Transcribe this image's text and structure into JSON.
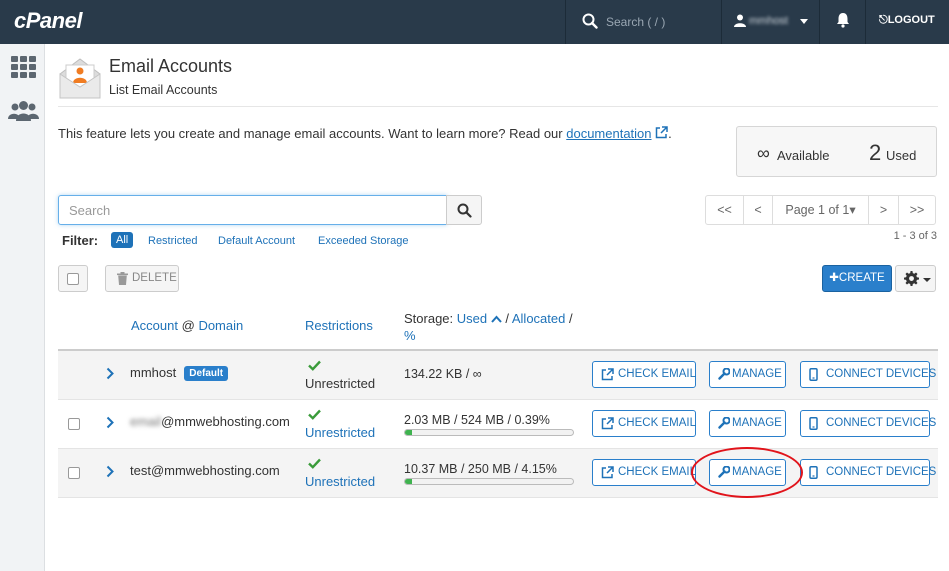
{
  "topbar": {
    "logo": "cPanel",
    "search_placeholder": "Search ( / )",
    "username": "mmhost",
    "logout_label": "LOGOUT"
  },
  "page": {
    "title": "Email Accounts",
    "subtitle": "List Email Accounts",
    "intro_text": "This feature lets you create and manage email accounts. Want to learn more? Read our ",
    "intro_link": "documentation",
    "intro_end": "."
  },
  "stats": {
    "available_symbol": "∞",
    "available_label": "Available",
    "used_count": "2",
    "used_label": "Used"
  },
  "search": {
    "placeholder": "Search"
  },
  "pagination": {
    "first": "<<",
    "prev": "<",
    "page_label": "Page 1 of 1",
    "next": ">",
    "last": ">>",
    "range": "1 - 3 of 3"
  },
  "filter": {
    "label": "Filter:",
    "options": [
      "All",
      "Restricted",
      "Default Account",
      "Exceeded Storage"
    ]
  },
  "actions": {
    "delete_label": "DELETE",
    "create_label": "CREATE"
  },
  "table": {
    "col_account": "Account",
    "col_at": "@",
    "col_domain": "Domain",
    "col_restrictions": "Restrictions",
    "storage_prefix": "Storage: ",
    "storage_used": "Used",
    "storage_sep1": " / ",
    "storage_allocated": "Allocated",
    "storage_sep2": " /",
    "storage_percent": "%"
  },
  "rows": [
    {
      "account": "mmhost",
      "badge": "Default",
      "restriction": "Unrestricted",
      "storage": "134.22 KB / ∞",
      "percent_used": null
    },
    {
      "account_blurred": "email",
      "account": "@mmwebhosting.com",
      "restriction": "Unrestricted",
      "storage": "2.03 MB / 524 MB / 0.39%",
      "percent_used": 0.39
    },
    {
      "account": "test@mmwebhosting.com",
      "restriction": "Unrestricted",
      "storage": "10.37 MB / 250 MB / 4.15%",
      "percent_used": 4.15
    }
  ],
  "row_buttons": {
    "check_email": "CHECK EMAIL",
    "manage": "MANAGE",
    "connect_devices": "CONNECT DEVICES"
  },
  "colors": {
    "topbar": "#293a4a",
    "link": "#1e72b8",
    "primary": "#2a7fcb",
    "success": "#3fb34f",
    "highlight": "#e1141b"
  },
  "icons": [
    "search-icon",
    "user-icon",
    "bell-icon",
    "logout-icon",
    "grid-icon",
    "users-icon",
    "envelope-icon",
    "external-link-icon",
    "trash-icon",
    "plus-icon",
    "gear-icon",
    "chevron-right-icon",
    "check-icon",
    "external-link-icon",
    "wrench-icon",
    "mobile-icon"
  ]
}
